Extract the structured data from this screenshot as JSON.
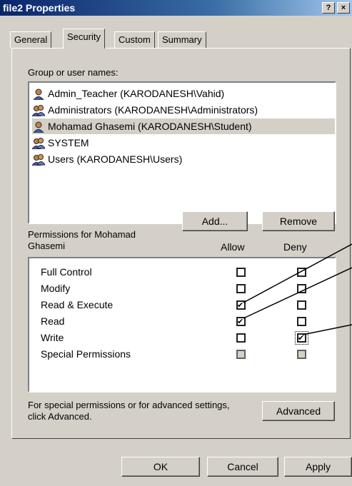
{
  "window": {
    "title": "file2 Properties",
    "help_label": "?",
    "close_label": "×"
  },
  "tabs": [
    {
      "label": "General"
    },
    {
      "label": "Security"
    },
    {
      "label": "Custom"
    },
    {
      "label": "Summary"
    }
  ],
  "group_section": {
    "label": "Group or user names:",
    "users": [
      {
        "name": "Admin_Teacher (KARODANESH\\Vahid)",
        "icon": "user-icon"
      },
      {
        "name": "Administrators (KARODANESH\\Administrators)",
        "icon": "group-icon"
      },
      {
        "name": "Mohamad Ghasemi (KARODANESH\\Student)",
        "icon": "user-icon",
        "selected": true
      },
      {
        "name": "SYSTEM",
        "icon": "group-icon"
      },
      {
        "name": "Users (KARODANESH\\Users)",
        "icon": "group-icon"
      }
    ],
    "add_label": "Add...",
    "remove_label": "Remove"
  },
  "permissions": {
    "label_line1": "Permissions for Mohamad",
    "label_line2": "Ghasemi",
    "allow_header": "Allow",
    "deny_header": "Deny",
    "rows": [
      {
        "name": "Full Control",
        "allow": false,
        "deny": false,
        "disabled": false
      },
      {
        "name": "Modify",
        "allow": false,
        "deny": false,
        "disabled": false
      },
      {
        "name": "Read & Execute",
        "allow": true,
        "deny": false,
        "disabled": false
      },
      {
        "name": "Read",
        "allow": true,
        "deny": false,
        "disabled": false
      },
      {
        "name": "Write",
        "allow": false,
        "deny": true,
        "disabled": false
      },
      {
        "name": "Special Permissions",
        "allow": false,
        "deny": false,
        "disabled": true
      }
    ]
  },
  "advanced": {
    "text_line1": "For special permissions or for advanced settings,",
    "text_line2": "click Advanced.",
    "button_label": "Advanced"
  },
  "footer": {
    "ok_label": "OK",
    "cancel_label": "Cancel",
    "apply_label": "Apply"
  }
}
